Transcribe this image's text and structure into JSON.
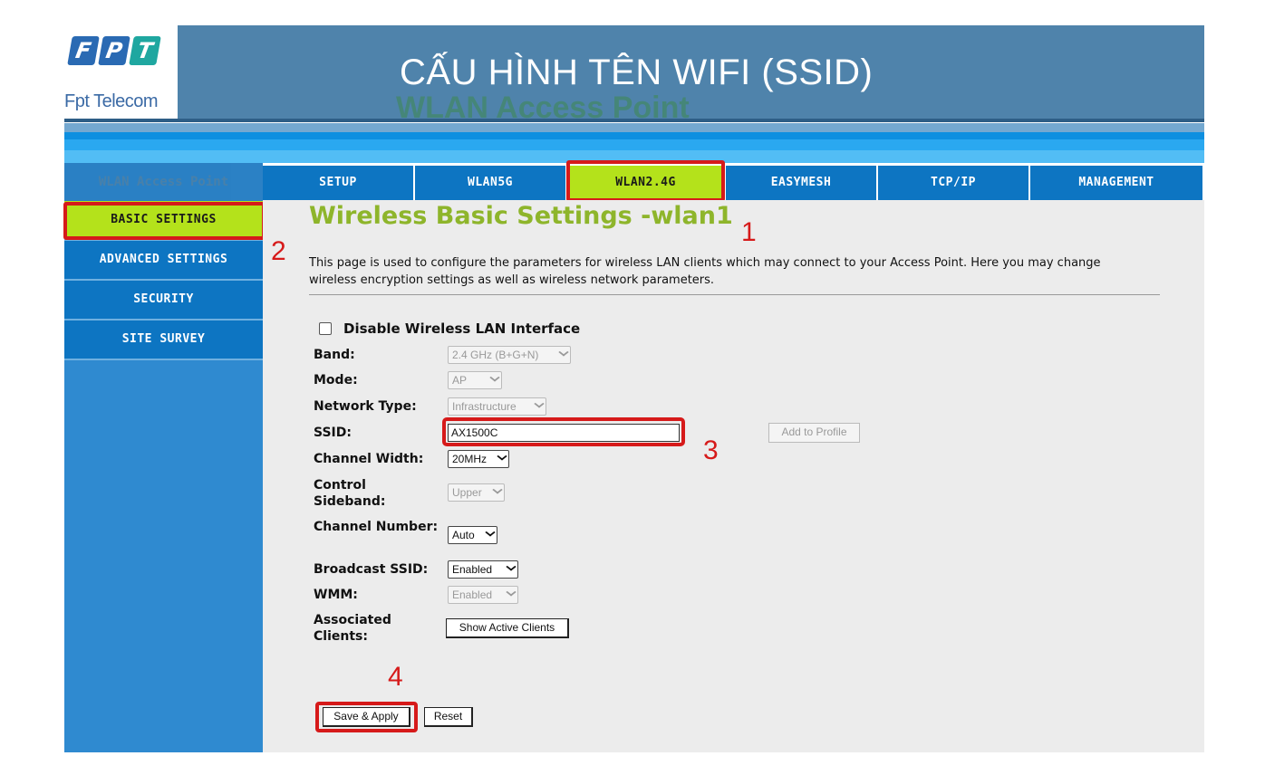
{
  "banner": {
    "logo_letters": [
      "F",
      "P",
      "T"
    ],
    "logo_caption": "Fpt Telecom",
    "ghost_title": "WLAN Access Point",
    "title": "CẤU HÌNH TÊN WIFI (SSID)"
  },
  "sidebar": {
    "header": "WLAN Access Point",
    "items": [
      {
        "label": "BASIC SETTINGS",
        "active": true
      },
      {
        "label": "ADVANCED SETTINGS",
        "active": false
      },
      {
        "label": "SECURITY",
        "active": false
      },
      {
        "label": "SITE SURVEY",
        "active": false
      }
    ]
  },
  "nav": {
    "tabs": [
      {
        "label": "SETUP",
        "active": false
      },
      {
        "label": "WLAN5G",
        "active": false
      },
      {
        "label": "WLAN2.4G",
        "active": true
      },
      {
        "label": "EASYMESH",
        "active": false
      },
      {
        "label": "TCP/IP",
        "active": false
      },
      {
        "label": "MANAGEMENT",
        "active": false
      }
    ]
  },
  "content": {
    "title": "Wireless Basic Settings -wlan1",
    "description": "This page is used to configure the parameters for wireless LAN clients which may connect to your Access Point. Here you may change wireless encryption settings as well as wireless network parameters.",
    "disable_label": "Disable Wireless LAN Interface",
    "disable_checked": false,
    "fields": {
      "band": {
        "label": "Band:",
        "value": "2.4 GHz (B+G+N)"
      },
      "mode": {
        "label": "Mode:",
        "value": "AP"
      },
      "network_type": {
        "label": "Network Type:",
        "value": "Infrastructure"
      },
      "ssid": {
        "label": "SSID:",
        "value": "AX1500C"
      },
      "channel_width": {
        "label": "Channel Width:",
        "value": "20MHz"
      },
      "control_sideband": {
        "label": "Control Sideband:",
        "value": "Upper"
      },
      "channel_number": {
        "label": "Channel Number:",
        "value": "Auto"
      },
      "broadcast_ssid": {
        "label": "Broadcast SSID:",
        "value": "Enabled"
      },
      "wmm": {
        "label": "WMM:",
        "value": "Enabled"
      },
      "associated_clients": {
        "label": "Associated Clients:"
      }
    },
    "add_to_profile_label": "Add to Profile",
    "show_active_clients_label": "Show Active Clients",
    "save_apply_label": "Save & Apply",
    "reset_label": "Reset"
  },
  "markers": {
    "m1": "1",
    "m2": "2",
    "m3": "3",
    "m4": "4"
  },
  "colors": {
    "banner": "#4f83ab",
    "nav_blue": "#0d75c2",
    "active_green": "#b4e21b",
    "title_green": "#8eb52b",
    "highlight_red": "#d61a1a",
    "content_bg": "#ececec",
    "logo_blue": "#2a6ab3",
    "logo_teal": "#1fa7a0"
  }
}
